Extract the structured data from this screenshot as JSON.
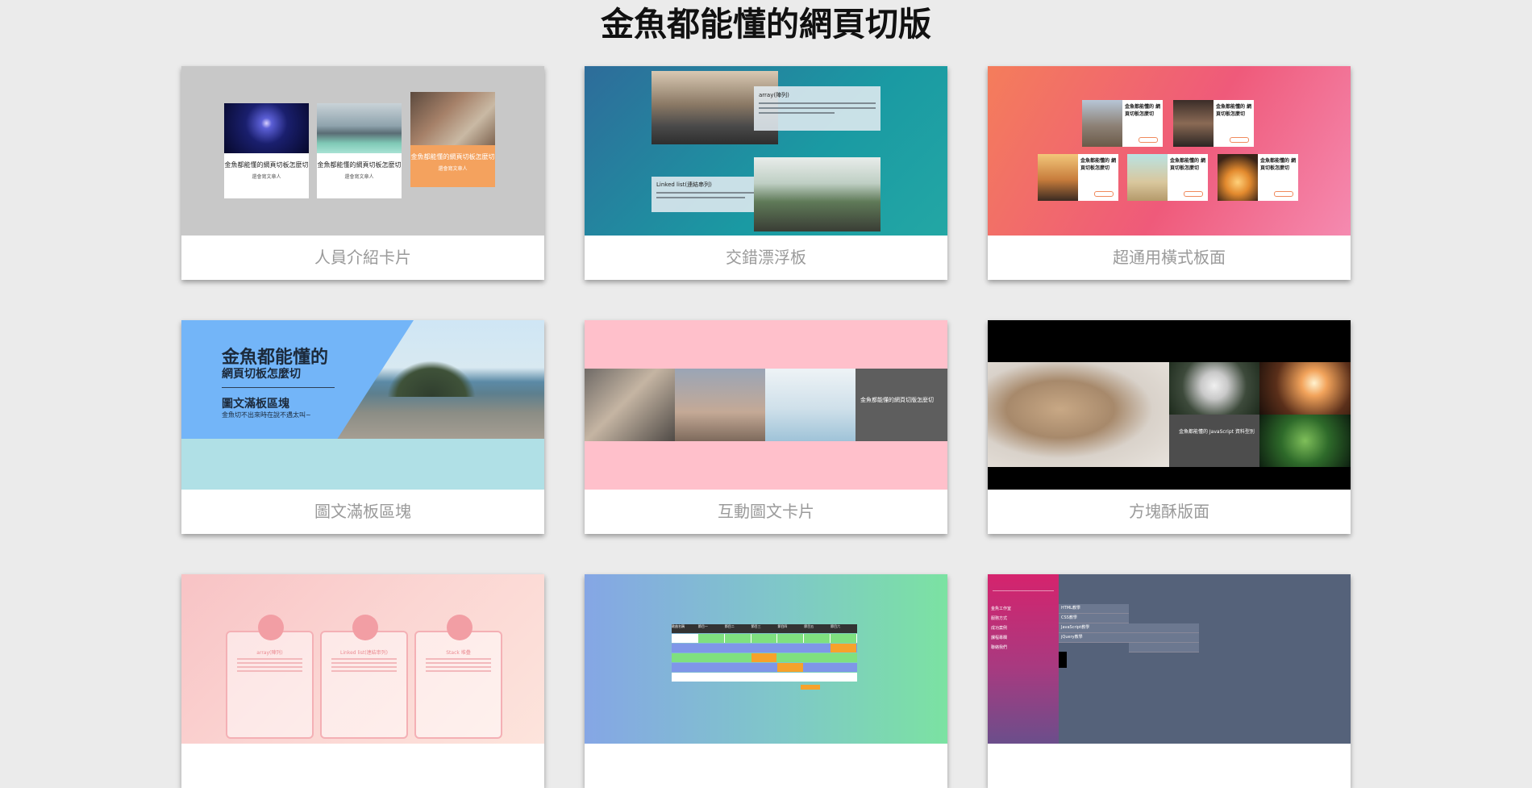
{
  "page": {
    "title": "金魚都能懂的網頁切版"
  },
  "cards": [
    {
      "caption": "人員介紹卡片",
      "preview": {
        "people": [
          {
            "name": "金魚都能懂的網頁切板怎麼切",
            "role": "還會寫文章人"
          },
          {
            "name": "金魚都能懂的網頁切板怎麼切",
            "role": "還會寫文章人"
          },
          {
            "name": "金魚都能懂的網頁切板怎麼切",
            "role": "還會寫文章人"
          }
        ]
      }
    },
    {
      "caption": "交錯漂浮板",
      "preview": {
        "panel1_title": "array(陣列)",
        "panel2_title": "Linked list(連結串列)"
      }
    },
    {
      "caption": "超通用橫式板面",
      "preview": {
        "item_title": "金魚都能懂的 網頁切板怎麼切"
      }
    },
    {
      "caption": "圖文滿板區塊",
      "preview": {
        "heading1": "金魚都能懂的",
        "heading2": "網頁切板怎麼切",
        "heading3": "圖文滿板區塊",
        "subtitle": "金魚切不出來時在說不遇太叫~"
      }
    },
    {
      "caption": "互動圖文卡片",
      "preview": {
        "overlay_title": "金魚都能懂的網頁切版怎麼切"
      }
    },
    {
      "caption": "方塊酥版面",
      "preview": {
        "overlay_title": "金魚都能懂的 JavaScript 資料型別"
      }
    },
    {
      "caption": "",
      "preview": {
        "boxes": [
          "array(陣列)",
          "Linked list(連結串列)",
          "Stack 堆疊"
        ]
      }
    },
    {
      "caption": "",
      "preview": {
        "headers": [
          "歌曲名稱",
          "節目一",
          "節目二",
          "節目三",
          "節目四",
          "節目五",
          "節目六"
        ]
      }
    },
    {
      "caption": "",
      "preview": {
        "menu": [
          "金魚工作室",
          "服務方式",
          "成功案例",
          "課程專欄",
          "聯絡我們"
        ],
        "submenu": [
          "HTML教學",
          "CSS教學",
          "JavaScript教學",
          "jQuery教學"
        ]
      }
    }
  ]
}
